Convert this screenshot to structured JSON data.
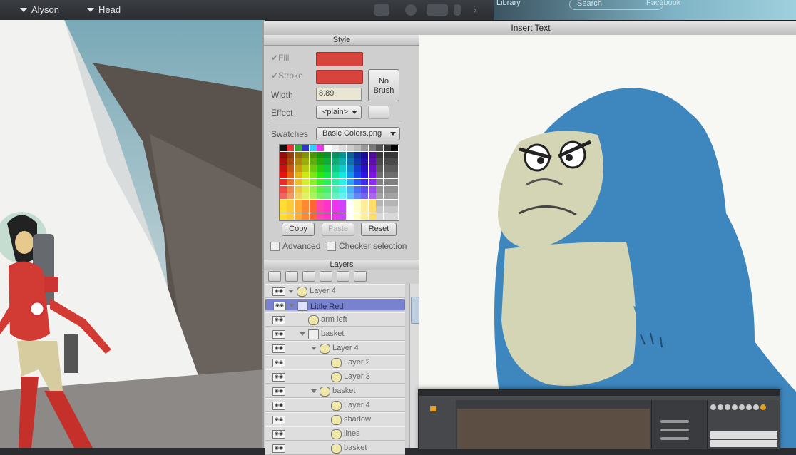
{
  "topbar": {
    "dropdown_1": "Alyson",
    "dropdown_2": "Head",
    "library_label": "Library",
    "search_placeholder": "Search",
    "right_label": "Facebook"
  },
  "window": {
    "title": "Insert Text"
  },
  "style_panel": {
    "title": "Style",
    "fill_label": "Fill",
    "stroke_label": "Stroke",
    "width_label": "Width",
    "width_value": "8.89",
    "effect_label": "Effect",
    "effect_value": "<plain>",
    "no_brush_label": "No Brush",
    "swatches_label": "Swatches",
    "swatches_value": "Basic Colors.png",
    "copy_button": "Copy",
    "paste_button": "Paste",
    "reset_button": "Reset",
    "advanced_label": "Advanced",
    "checker_label": "Checker selection",
    "fill_color": "#d7433d",
    "stroke_color": "#d7433d"
  },
  "layers_panel": {
    "title": "Layers",
    "rows": [
      {
        "name": "Layer 4",
        "indent": 0,
        "selected": false,
        "kind": "folder"
      },
      {
        "name": "Little Red",
        "indent": 0,
        "selected": true,
        "kind": "bone"
      },
      {
        "name": "arm left",
        "indent": 1,
        "selected": false,
        "kind": "vector"
      },
      {
        "name": "basket",
        "indent": 1,
        "selected": false,
        "kind": "group"
      },
      {
        "name": "Layer 4",
        "indent": 2,
        "selected": false,
        "kind": "folder"
      },
      {
        "name": "Layer 2",
        "indent": 3,
        "selected": false,
        "kind": "vector"
      },
      {
        "name": "Layer 3",
        "indent": 3,
        "selected": false,
        "kind": "vector"
      },
      {
        "name": "basket",
        "indent": 2,
        "selected": false,
        "kind": "folder"
      },
      {
        "name": "Layer 4",
        "indent": 3,
        "selected": false,
        "kind": "vector"
      },
      {
        "name": "shadow",
        "indent": 3,
        "selected": false,
        "kind": "vector"
      },
      {
        "name": "lines",
        "indent": 3,
        "selected": false,
        "kind": "vector"
      },
      {
        "name": "basket",
        "indent": 3,
        "selected": false,
        "kind": "vector"
      }
    ]
  },
  "colors": {
    "selected_row": "#7882cf",
    "gorilla_blue": "#3d86be",
    "gorilla_face": "#d4d5b4"
  }
}
